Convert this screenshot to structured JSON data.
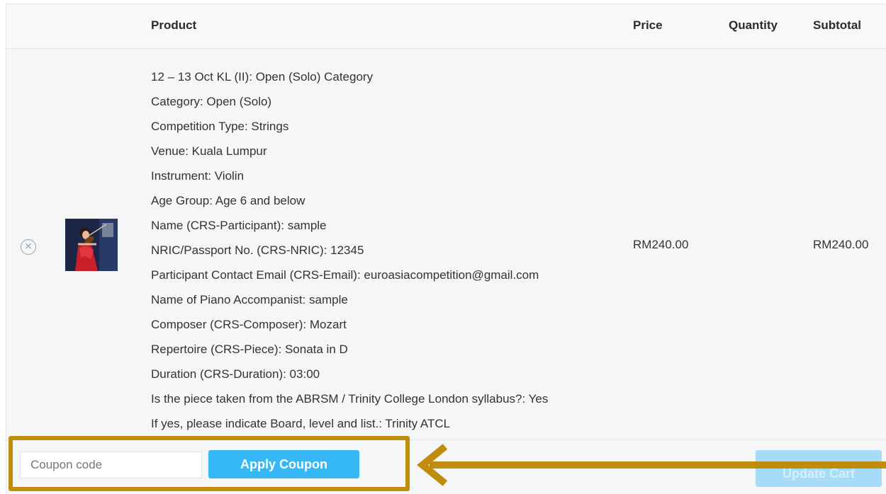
{
  "table": {
    "headers": {
      "product": "Product",
      "price": "Price",
      "quantity": "Quantity",
      "subtotal": "Subtotal"
    },
    "item": {
      "remove_icon": "circle-x",
      "thumbnail": "violinist-photo",
      "lines": [
        "12 – 13 Oct KL (II): Open (Solo) Category",
        "Category: Open (Solo)",
        "Competition Type: Strings",
        "Venue: Kuala Lumpur",
        "Instrument: Violin",
        "Age Group: Age 6 and below",
        "Name (CRS-Participant): sample",
        "NRIC/Passport No. (CRS-NRIC): 12345",
        "Participant Contact Email (CRS-Email): euroasiacompetition@gmail.com",
        "Name of Piano Accompanist: sample",
        "Composer (CRS-Composer): Mozart",
        "Repertoire (CRS-Piece): Sonata in D",
        "Duration (CRS-Duration): 03:00",
        "Is the piece taken from the ABRSM / Trinity College London syllabus?: Yes",
        "If yes, please indicate Board, level and list.: Trinity ATCL"
      ],
      "price": "RM240.00",
      "subtotal": "RM240.00"
    }
  },
  "actions": {
    "coupon_placeholder": "Coupon code",
    "apply_label": "Apply Coupon",
    "update_label": "Update Cart"
  },
  "colors": {
    "accent": "#35b8f5",
    "highlight": "#bf8c0c",
    "update_disabled": "#a6dcf8"
  }
}
